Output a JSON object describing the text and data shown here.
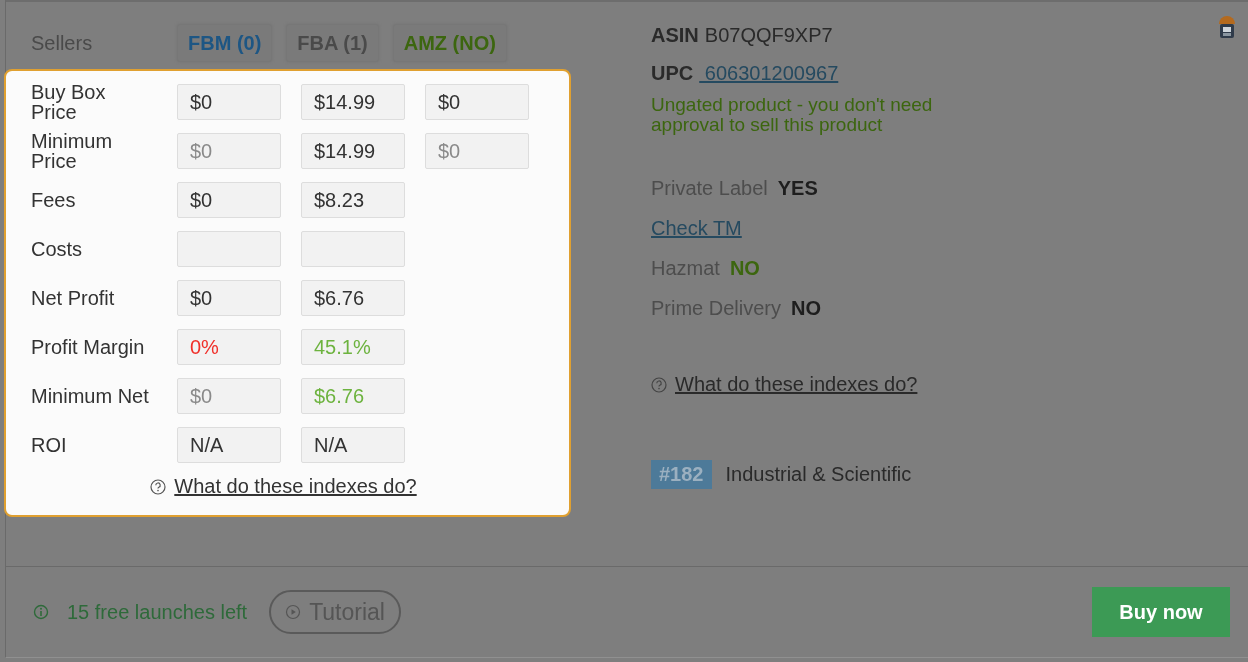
{
  "sellers": {
    "label": "Sellers",
    "tabs": [
      {
        "label": "FBM (0)",
        "color": "#1d5684"
      },
      {
        "label": "FBA (1)",
        "color": "#4a4a4a"
      },
      {
        "label": "AMZ (NO)",
        "color": "#3c660f"
      }
    ]
  },
  "metrics": {
    "rows": [
      {
        "label": "Buy Box Price",
        "cells": [
          {
            "kind": "value",
            "text": "$0",
            "color": "#333333"
          },
          {
            "kind": "value",
            "text": "$14.99",
            "color": "#333333"
          },
          {
            "kind": "value",
            "text": "$0",
            "color": "#333333"
          }
        ]
      },
      {
        "label": "Minimum Price",
        "cells": [
          {
            "kind": "value",
            "text": "$0",
            "color": "#8a8a8a"
          },
          {
            "kind": "value",
            "text": "$14.99",
            "color": "#333333"
          },
          {
            "kind": "value",
            "text": "$0",
            "color": "#8a8a8a"
          }
        ]
      },
      {
        "label": "Fees",
        "cells": [
          {
            "kind": "value",
            "text": "$0",
            "color": "#333333"
          },
          {
            "kind": "value",
            "text": "$8.23",
            "color": "#333333"
          }
        ]
      },
      {
        "label": "Costs",
        "cells": [
          {
            "kind": "empty"
          },
          {
            "kind": "empty"
          }
        ]
      },
      {
        "label": "Net Profit",
        "cells": [
          {
            "kind": "value",
            "text": "$0",
            "color": "#333333"
          },
          {
            "kind": "value",
            "text": "$6.76",
            "color": "#333333"
          }
        ]
      },
      {
        "label": "Profit Margin",
        "cells": [
          {
            "kind": "value",
            "text": "0%",
            "color": "#f0302a"
          },
          {
            "kind": "value",
            "text": "45.1%",
            "color": "#6db33f"
          }
        ]
      },
      {
        "label": "Minimum Net",
        "cells": [
          {
            "kind": "value",
            "text": "$0",
            "color": "#8a8a8a"
          },
          {
            "kind": "value",
            "text": "$6.76",
            "color": "#6db33f"
          }
        ]
      },
      {
        "label": "ROI",
        "cells": [
          {
            "kind": "value",
            "text": "N/A",
            "color": "#333333"
          },
          {
            "kind": "value",
            "text": "N/A",
            "color": "#333333"
          }
        ]
      }
    ],
    "help_link": "What do these indexes do?"
  },
  "product": {
    "asin_label": "ASIN",
    "asin": "B07QQF9XP7",
    "upc_label": "UPC",
    "upc": " 606301200967",
    "gating": "Ungated product - you don't need approval to sell this product",
    "private_label": {
      "label": "Private Label",
      "value": "YES",
      "color": "#1e1e1e"
    },
    "check_tm": "Check TM",
    "hazmat": {
      "label": "Hazmat",
      "value": "NO",
      "color": "#3c660f"
    },
    "prime": {
      "label": "Prime Delivery",
      "value": "NO",
      "color": "#1e1e1e"
    },
    "help_link": "What do these indexes do?",
    "rank": "#182",
    "category": "Industrial & Scientific"
  },
  "footer": {
    "launches": "15 free launches left",
    "tutorial": "Tutorial",
    "buy": "Buy now"
  }
}
